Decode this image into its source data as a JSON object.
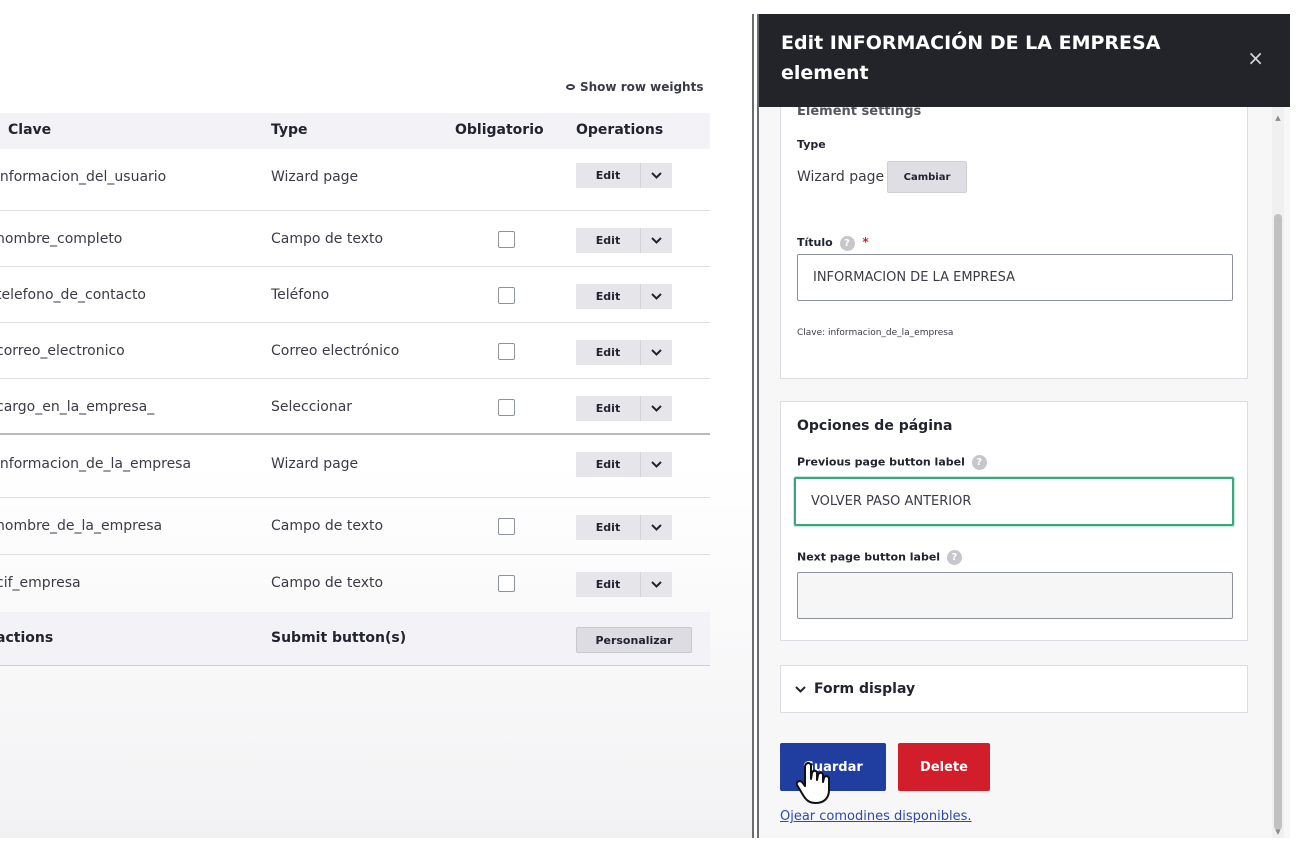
{
  "table": {
    "show_row_weights": "Show row weights",
    "headers": {
      "clave": "Clave",
      "type": "Type",
      "obligatorio": "Obligatorio",
      "operations": "Operations"
    },
    "rows": [
      {
        "key": "informacion_del_usuario",
        "type": "Wizard page",
        "has_checkbox": false
      },
      {
        "key": "nombre_completo",
        "type": "Campo de texto",
        "has_checkbox": true
      },
      {
        "key": "telefono_de_contacto",
        "type": "Teléfono",
        "has_checkbox": true
      },
      {
        "key": "correo_electronico",
        "type": "Correo electrónico",
        "has_checkbox": true
      },
      {
        "key": "cargo_en_la_empresa_",
        "type": "Seleccionar",
        "has_checkbox": true
      },
      {
        "key": "informacion_de_la_empresa",
        "type": "Wizard page",
        "has_checkbox": false
      },
      {
        "key": "nombre_de_la_empresa",
        "type": "Campo de texto",
        "has_checkbox": true
      },
      {
        "key": "cif_empresa",
        "type": "Campo de texto",
        "has_checkbox": true
      }
    ],
    "edit_label": "Edit",
    "footer": {
      "key": "actions",
      "type": "Submit button(s)",
      "button": "Personalizar"
    }
  },
  "dialog": {
    "title": "Edit INFORMACIÓN DE LA EMPRESA element",
    "close": "×",
    "element_settings": {
      "legend": "Element settings",
      "type_label": "Type",
      "type_value": "Wizard page",
      "change_button": "Cambiar",
      "title_label": "Título",
      "title_value": "INFORMACIÓN DE LA EMPRESA",
      "help_glyph": "?",
      "required_mark": "*",
      "key_note": "Clave: informacion_de_la_empresa"
    },
    "page_options": {
      "heading": "Opciones de página",
      "prev_label": "Previous page button label",
      "prev_value": "VOLVER PASO ANTERIOR",
      "next_label": "Next page button label",
      "next_value": ""
    },
    "form_display": "Form display",
    "save_button": "Guardar",
    "delete_button": "Delete",
    "tokens_link": "Ojear comodines disponibles."
  },
  "colors": {
    "header_bg": "#232429",
    "primary": "#203da0",
    "danger": "#d21d2a",
    "focus": "#3aa57e"
  }
}
